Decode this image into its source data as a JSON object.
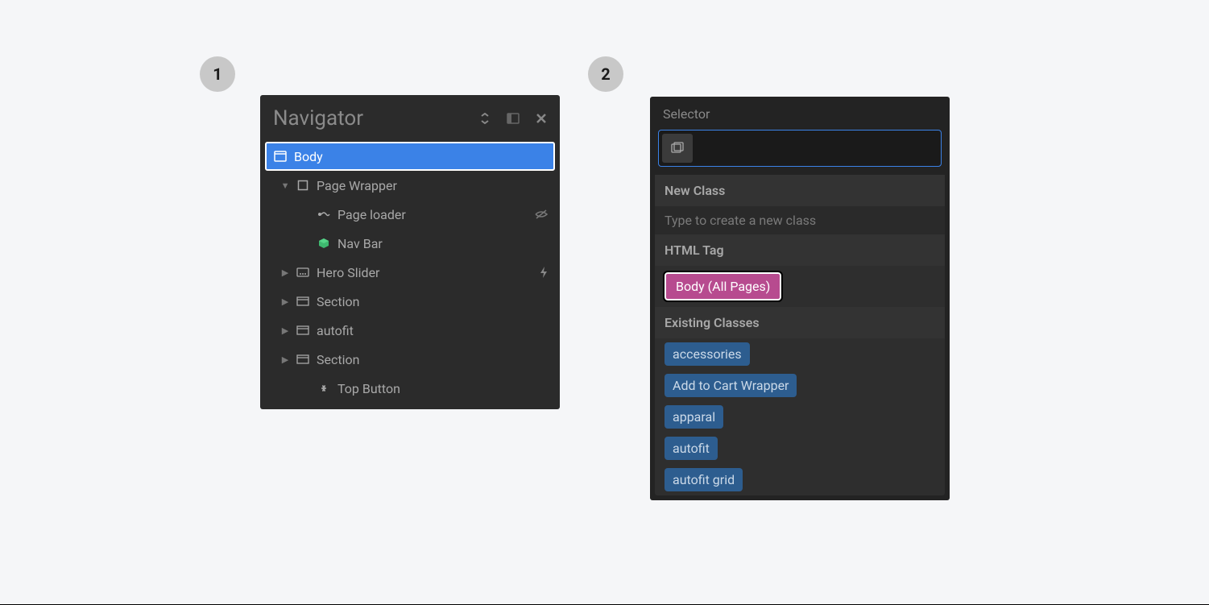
{
  "steps": {
    "one": "1",
    "two": "2"
  },
  "navigator": {
    "title": "Navigator",
    "items": [
      {
        "label": "Body",
        "icon": "window-icon",
        "selected": true,
        "indent": 0,
        "caret": ""
      },
      {
        "label": "Page Wrapper",
        "icon": "square-icon",
        "indent": 1,
        "caret": "down"
      },
      {
        "label": "Page loader",
        "icon": "interaction-icon",
        "indent": 2,
        "caret": "",
        "trail": "hidden-icon"
      },
      {
        "label": "Nav Bar",
        "icon": "cube-icon",
        "indent": 2,
        "caret": ""
      },
      {
        "label": "Hero Slider",
        "icon": "slider-icon",
        "indent": 1,
        "caret": "right",
        "trail": "bolt-icon"
      },
      {
        "label": "Section",
        "icon": "section-icon",
        "indent": 1,
        "caret": "right"
      },
      {
        "label": "autofit",
        "icon": "section-icon",
        "indent": 1,
        "caret": "right"
      },
      {
        "label": "Section",
        "icon": "section-icon",
        "indent": 1,
        "caret": "right"
      },
      {
        "label": "Top Button",
        "icon": "link-icon",
        "indent": 2,
        "caret": ""
      }
    ]
  },
  "selector": {
    "label": "Selector",
    "input_value": "",
    "new_class_header": "New Class",
    "new_class_hint": "Type to create a new class",
    "html_tag_header": "HTML Tag",
    "html_tag_value": "Body (All Pages)",
    "existing_header": "Existing Classes",
    "existing_classes": [
      "accessories",
      "Add to Cart Wrapper",
      "apparal",
      "autofit",
      "autofit grid"
    ]
  }
}
